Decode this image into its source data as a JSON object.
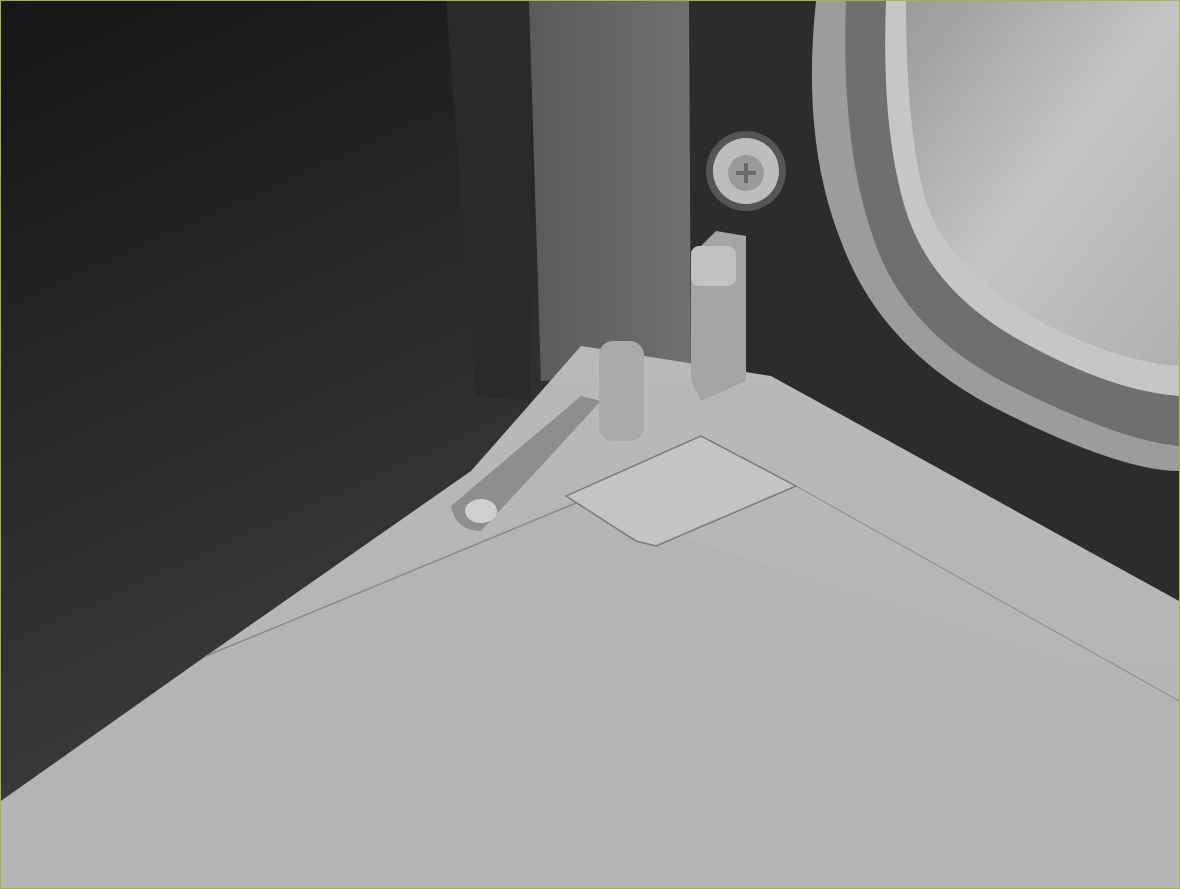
{
  "viewport": {
    "active_border_color": "#a9b43c",
    "scene": "3d-render-hinge-bracket",
    "colors": {
      "background_dark": "#1c1c1c",
      "wall_dark": "#2b2b2b",
      "panel_light": "#6c6c6c",
      "surface": "#b7b7b7",
      "frame": "#a8a8a8"
    }
  }
}
